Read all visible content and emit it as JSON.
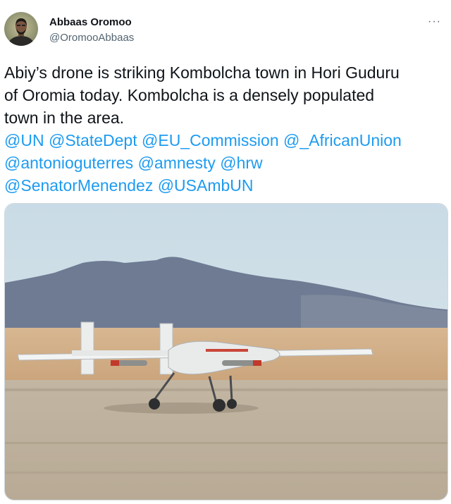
{
  "tweet": {
    "author_name": "Abbaas Oromoo",
    "author_handle": "@OromooAbbaas",
    "more_icon": "more-horizontal-icon",
    "text_lines": [
      "Abiy’s drone is striking Kombolcha town in Hori Guduru",
      "of Oromia today. Kombolcha is a densely populated",
      "town in the area."
    ],
    "mentions": [
      "@UN",
      "@StateDept",
      "@EU_Commission",
      "@_AfricanUnion",
      "@antonioguterres",
      "@amnesty",
      "@hrw",
      "@SenatorMenendez",
      "@USAmbUN"
    ],
    "media": {
      "subject": "drone on desert runway"
    }
  },
  "colors": {
    "link": "#1d9bf0",
    "text": "#0f1419",
    "secondary": "#536471"
  }
}
